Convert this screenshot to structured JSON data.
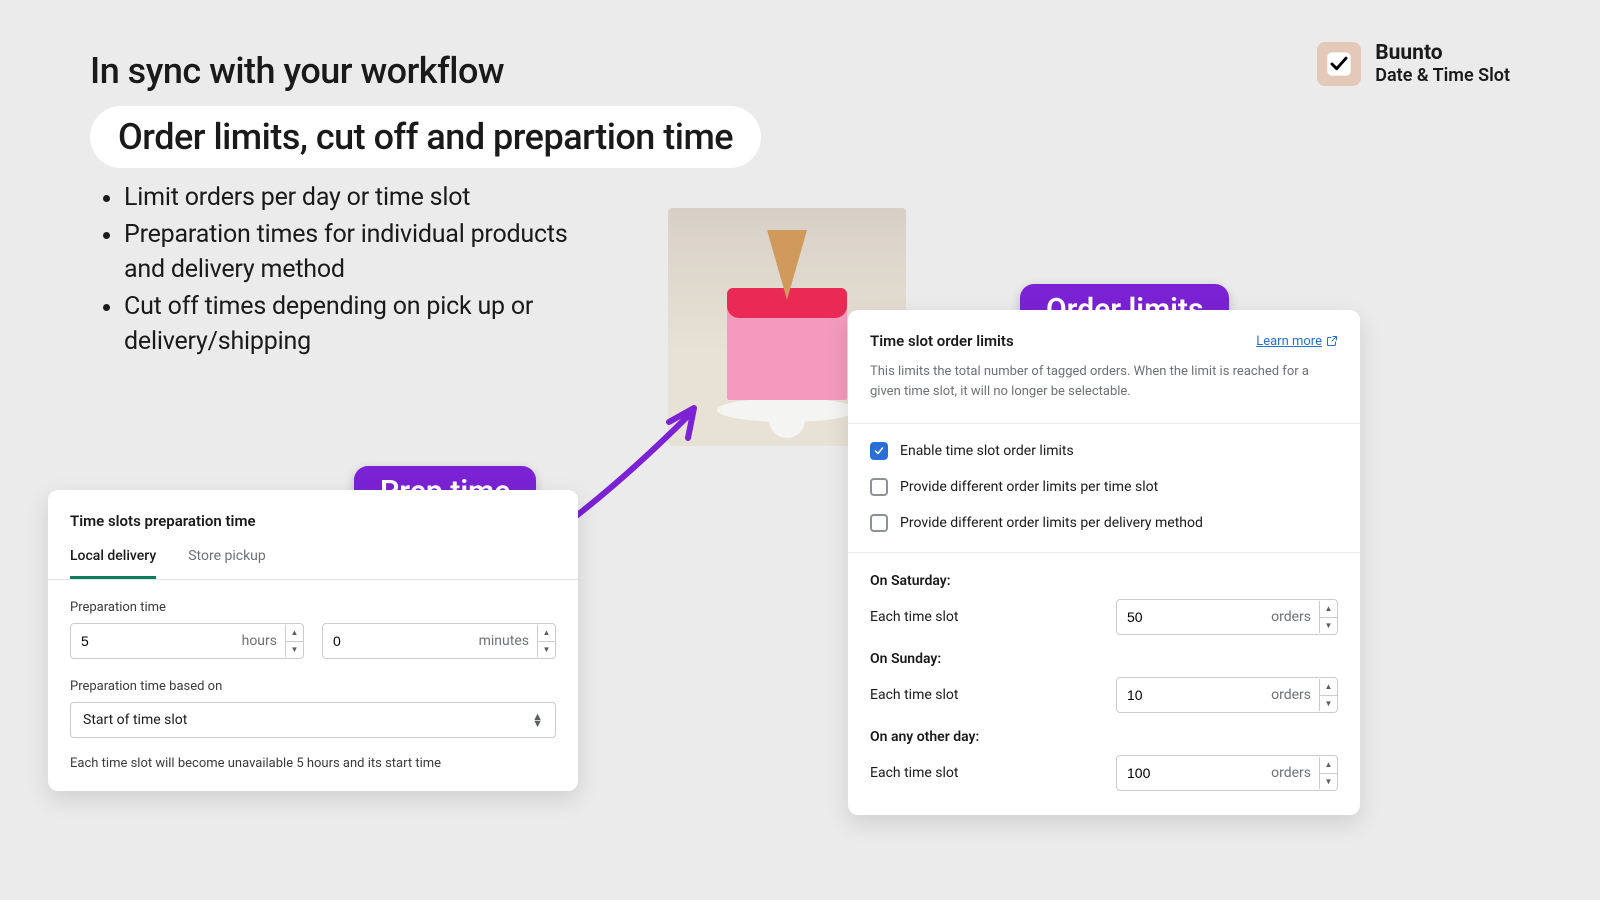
{
  "brand": {
    "name": "Buunto",
    "tagline": "Date & Time Slot"
  },
  "hero": {
    "line1": "In sync with your workflow",
    "line2": "Order limits, cut off and prepartion time"
  },
  "bullets": [
    "Limit orders per day or time slot",
    "Preparation times for individual products and delivery method",
    "Cut off times depending on pick up or delivery/shipping"
  ],
  "badges": {
    "prep": "Prep time",
    "order": "Order limits"
  },
  "prep_card": {
    "title": "Time slots preparation time",
    "tabs": [
      "Local delivery",
      "Store pickup"
    ],
    "active_tab": 0,
    "labels": {
      "prep_time": "Preparation time",
      "hours_suffix": "hours",
      "minutes_suffix": "minutes",
      "based_on": "Preparation time based on"
    },
    "values": {
      "hours": "5",
      "minutes": "0",
      "based_on": "Start of time slot"
    },
    "help": "Each time slot will become unavailable 5 hours and its start time"
  },
  "order_card": {
    "title": "Time slot order limits",
    "learn_more": "Learn more",
    "description": "This limits the total number of tagged orders. When the limit is reached for a given time slot, it will no longer be selectable.",
    "checkboxes": [
      {
        "label": "Enable time slot order limits",
        "checked": true
      },
      {
        "label": "Provide different order limits per time slot",
        "checked": false
      },
      {
        "label": "Provide different order limits per delivery method",
        "checked": false
      }
    ],
    "orders_suffix": "orders",
    "each_label": "Each time slot",
    "limits": [
      {
        "heading": "On Saturday:",
        "value": "50"
      },
      {
        "heading": "On Sunday:",
        "value": "10"
      },
      {
        "heading": "On any other day:",
        "value": "100"
      }
    ]
  }
}
